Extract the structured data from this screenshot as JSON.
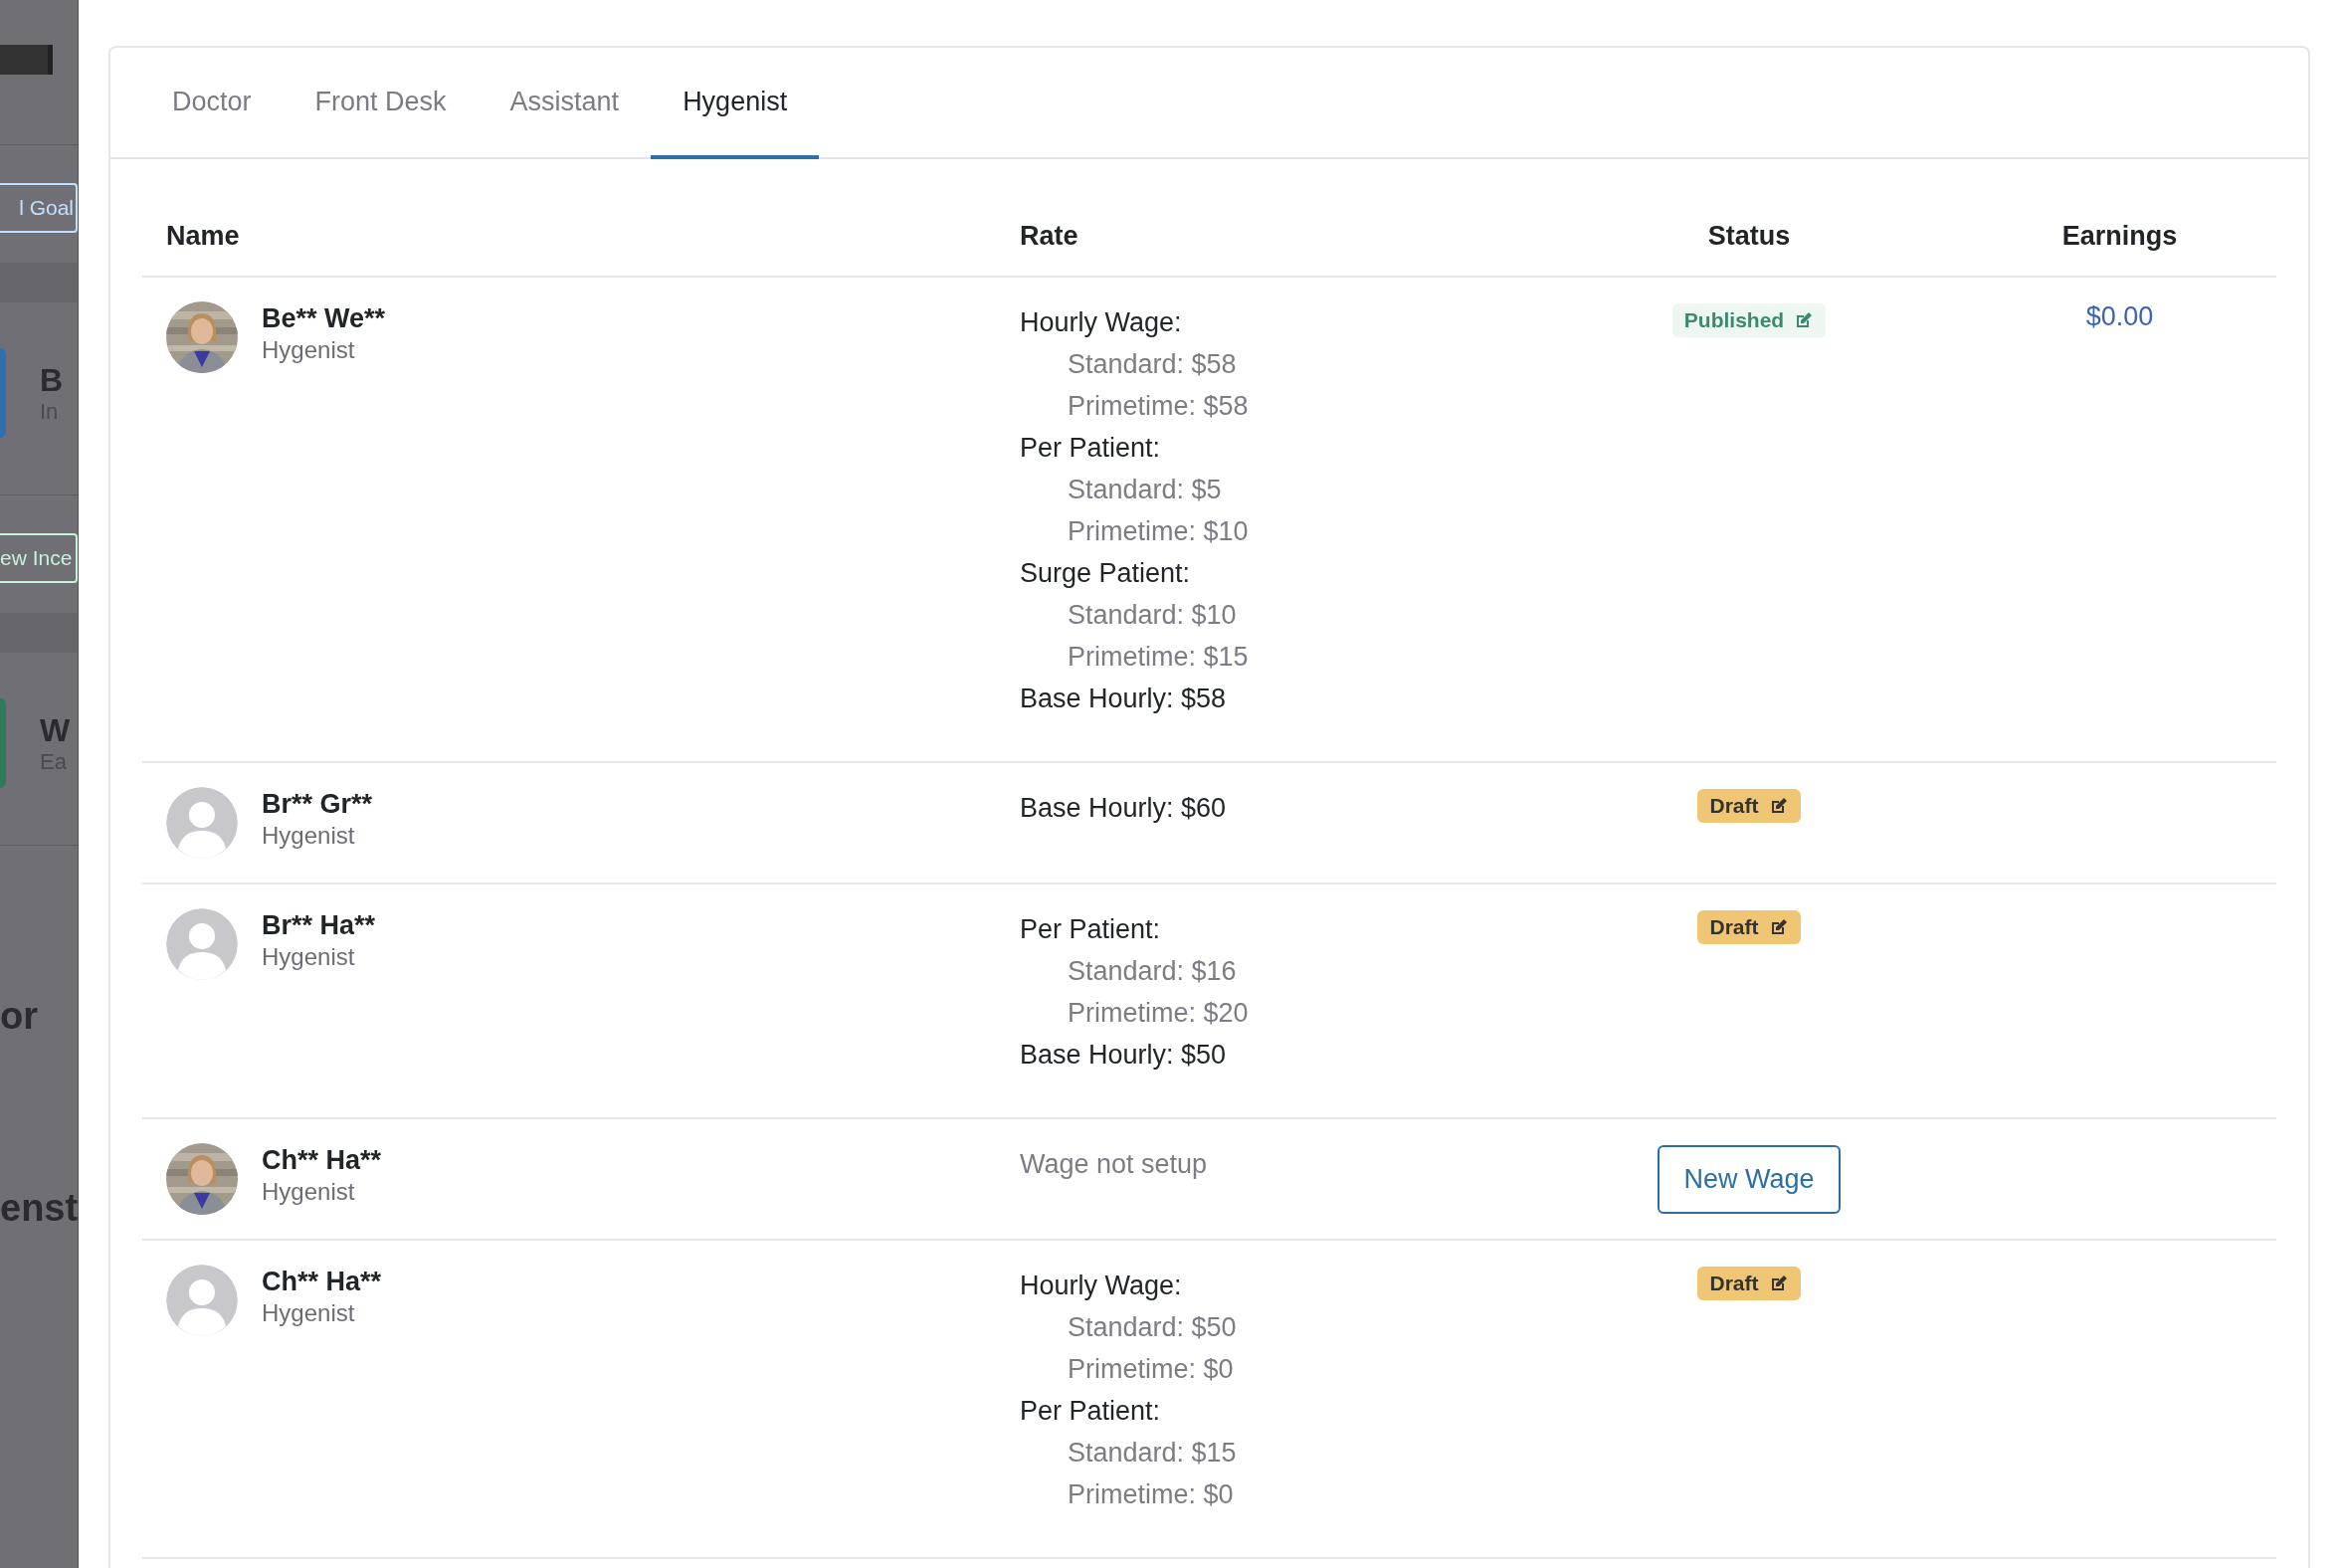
{
  "background_page": {
    "texts": [
      {
        "kind": "button",
        "text": "l Goal",
        "color": "#bfe0ff"
      },
      {
        "kind": "title",
        "text": "B",
        "color": "#2f6fb0"
      },
      {
        "kind": "subtitle",
        "text": "In"
      },
      {
        "kind": "button",
        "text": "ew Ince",
        "color": "#c4f2da"
      },
      {
        "kind": "title",
        "text": "W",
        "color": "#2f7a5a"
      },
      {
        "kind": "subtitle",
        "text": "Ea"
      },
      {
        "kind": "heading",
        "text": "or"
      },
      {
        "kind": "heading",
        "text": "enst"
      }
    ]
  },
  "tabs": [
    {
      "label": "Doctor",
      "selected": false
    },
    {
      "label": "Front Desk",
      "selected": false
    },
    {
      "label": "Assistant",
      "selected": false
    },
    {
      "label": "Hygenist",
      "selected": true
    }
  ],
  "table": {
    "columns": [
      "Name",
      "Rate",
      "Status",
      "Earnings"
    ],
    "rows": [
      {
        "name": "Be** We**",
        "role": "Hygenist",
        "rate": [
          {
            "kind": "heading",
            "text": "Hourly Wage:"
          },
          {
            "kind": "item",
            "text": "Standard: $58"
          },
          {
            "kind": "item",
            "text": "Primetime: $58"
          },
          {
            "kind": "heading",
            "text": "Per Patient:"
          },
          {
            "kind": "item",
            "text": "Standard: $5"
          },
          {
            "kind": "item",
            "text": "Primetime: $10"
          },
          {
            "kind": "heading",
            "text": "Surge Patient:"
          },
          {
            "kind": "item",
            "text": "Standard: $10"
          },
          {
            "kind": "item",
            "text": "Primetime: $15"
          },
          {
            "kind": "heading",
            "text": "Base Hourly: $58"
          }
        ],
        "status": {
          "kind": "published",
          "label": "Published"
        },
        "earnings": "$0.00"
      },
      {
        "name": "Br** Gr**",
        "role": "Hygenist",
        "avatar": {
          "kind": "placeholder"
        },
        "rate": [
          {
            "kind": "heading",
            "text": "Base Hourly: $60"
          }
        ],
        "status": {
          "kind": "draft",
          "label": "Draft"
        }
      },
      {
        "name": "Br** Ha**",
        "role": "Hygenist",
        "avatar": {
          "kind": "placeholder"
        },
        "rate": [
          {
            "kind": "heading",
            "text": "Per Patient:"
          },
          {
            "kind": "item",
            "text": "Standard: $16"
          },
          {
            "kind": "item",
            "text": "Primetime: $20"
          },
          {
            "kind": "heading",
            "text": "Base Hourly: $50"
          }
        ],
        "status": {
          "kind": "draft",
          "label": "Draft"
        }
      },
      {
        "name": "Ch** Ha**",
        "role": "Hygenist",
        "rate": [
          {
            "kind": "note",
            "text": "Wage not setup"
          }
        ],
        "status": {
          "kind": "button",
          "label": "New Wage"
        }
      },
      {
        "name": "Ch** Ha**",
        "role": "Hygenist",
        "avatar": {
          "kind": "placeholder"
        },
        "rate": [
          {
            "kind": "heading",
            "text": "Hourly Wage:"
          },
          {
            "kind": "item",
            "text": "Standard: $50"
          },
          {
            "kind": "item",
            "text": "Primetime: $0"
          },
          {
            "kind": "heading",
            "text": "Per Patient:"
          },
          {
            "kind": "item",
            "text": "Standard: $15"
          },
          {
            "kind": "item",
            "text": "Primetime: $0"
          }
        ],
        "status": {
          "kind": "draft",
          "label": "Draft"
        }
      }
    ]
  }
}
